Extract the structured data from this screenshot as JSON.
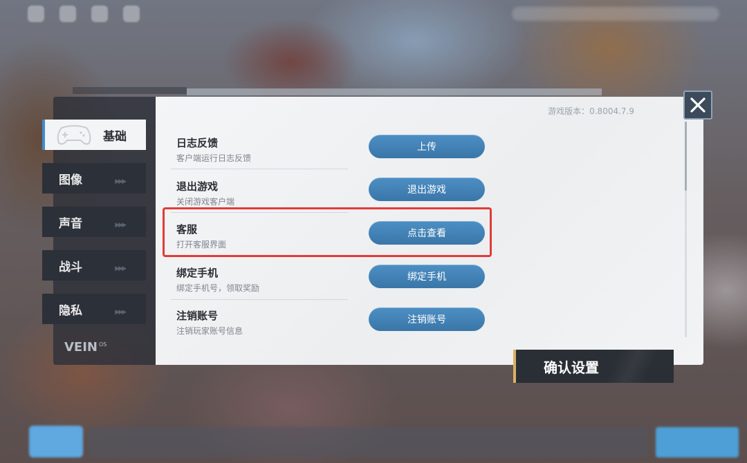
{
  "settings": {
    "version_text": "游戏版本：0.8004.7.9",
    "tabs": [
      {
        "label": "基础",
        "active": true
      },
      {
        "label": "图像",
        "active": false
      },
      {
        "label": "声音",
        "active": false
      },
      {
        "label": "战斗",
        "active": false
      },
      {
        "label": "隐私",
        "active": false
      }
    ],
    "brand": {
      "logo": "VEIN",
      "sup": "OS"
    },
    "rows": [
      {
        "title": "日志反馈",
        "desc": "客户端运行日志反馈",
        "button": "上传"
      },
      {
        "title": "退出游戏",
        "desc": "关闭游戏客户端",
        "button": "退出游戏"
      },
      {
        "title": "客服",
        "desc": "打开客服界面",
        "button": "点击查看"
      },
      {
        "title": "绑定手机",
        "desc": "绑定手机号，领取奖励",
        "button": "绑定手机"
      },
      {
        "title": "注销账号",
        "desc": "注销玩家账号信息",
        "button": "注销账号"
      }
    ],
    "highlighted_row": "客服",
    "confirm_label": "确认设置",
    "icons": {
      "close": "close-icon",
      "tab_arrows": "double-chevron-right-icon",
      "active_tab": "gamepad-icon"
    },
    "colors": {
      "button": "#4285bb",
      "highlight": "#e23b36",
      "active_tab_accent": "#3e8ccd",
      "confirm_accent": "#d8b264"
    }
  }
}
